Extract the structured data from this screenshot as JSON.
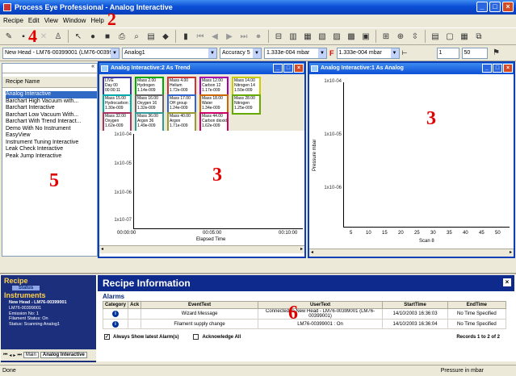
{
  "window": {
    "title": "Process Eye Professional - Analog Interactive"
  },
  "menu": [
    "Recipe",
    "Edit",
    "View",
    "Window",
    "Help"
  ],
  "callouts": {
    "menu": "2",
    "toolbar": "4",
    "left": "5",
    "trend": "3",
    "analog": "3",
    "bottom": "6"
  },
  "toolbar2": {
    "head": "New Head - LM76-00399001 (LM76-00399",
    "analog": "Analog1",
    "accuracy": "Accuracy 5",
    "start_mass": "1.333e-004 mbar",
    "end_mass": "1.333e-004 mbar",
    "value1": "1",
    "value2": "50"
  },
  "left_panel": {
    "header": "Recipe Name",
    "items": [
      "Analog Interactive",
      "Barchart High Vacuum with...",
      "Barchart Interactive",
      "Barchart Low Vacuum With...",
      "Barchart With Trend Interact...",
      "Demo With No Instrument",
      "EasyView",
      "Instrument Tuning Interactive",
      "Leak Check Interactive",
      "Peak Jump Interactive"
    ]
  },
  "trend_window": {
    "title": "Analog Interactive:2 As Trend",
    "cells": [
      {
        "label": "LIVE\nDay 00\n00:00:11",
        "color": "#3333aa"
      },
      {
        "label": "Mass 2.00\nHydrogen\n1.14e-009",
        "color": "#00aa00"
      },
      {
        "label": "Mass 4.00\nHelium\n1.72e-009",
        "color": "#cc3333"
      },
      {
        "label": "Mass 12.00\nCarbon 12\n1.17e-009",
        "color": "#aa00aa"
      },
      {
        "label": "Mass 14.00\nNitrogen 14\n1.50e-009",
        "color": "#cccc00"
      },
      {
        "label": "Mass 15.00\nHydrocarbon 15\n1.30e-009",
        "color": "#00aaaa"
      },
      {
        "label": "Mass 16.00\nOxygen 16\n1.32e-009",
        "color": "#666666"
      },
      {
        "label": "Mass 17.00\nOH group\n1.24e-009",
        "color": "#3366cc"
      },
      {
        "label": "Mass 18.00\nWater\n1.34e-009",
        "color": "#cc6600"
      },
      {
        "label": "Mass 28.00\nNitrogen\n1.25e-009",
        "color": "#66aa00"
      },
      {
        "label": "Mass 32.00\nOxygen\n1.62e-009",
        "color": "#aa3366"
      },
      {
        "label": "Mass 36.00\nArgon 36\n1.49e-009",
        "color": "#339999"
      },
      {
        "label": "Mass 40.00\nArgon\n1.71e-009",
        "color": "#999933"
      },
      {
        "label": "Mass 44.00\nCarbon dioxide\n1.62e-009",
        "color": "#cc0066"
      }
    ],
    "y_ticks": [
      "1x10-04",
      "1x10-05",
      "1x10-06",
      "1x10-07"
    ],
    "x_ticks": [
      "00:00:00",
      "00:05:00",
      "00:10:00"
    ],
    "xlabel": "Elapsed Time"
  },
  "analog_window": {
    "title": "Analog Interactive:1 As Analog",
    "y_ticks": [
      "1x10-04",
      "1x10-05",
      "1x10-06"
    ],
    "ylabel": "Pressure mbar",
    "x_ticks": [
      "5",
      "10",
      "15",
      "20",
      "25",
      "30",
      "35",
      "40",
      "45",
      "50"
    ],
    "xlabel": "Scan 8"
  },
  "bottom": {
    "recipe_header": "Recipe",
    "status_label": "Status",
    "instruments_header": "Instruments",
    "instrument_lines": [
      "New Head - LM76-00399001",
      "LM76-00399001",
      "Emission No: 1",
      "Filament Status: On",
      "Status: Scanning Analog1"
    ],
    "title": "Recipe Information",
    "alarms_title": "Alarms",
    "columns": [
      "Category",
      "Ack",
      "EventText",
      "UserText",
      "StartTime",
      "EndTime"
    ],
    "rows": [
      {
        "event": "Wizard Message",
        "user": "Connected to New Head - LM76-00399001 (LM76-00399001)",
        "start": "14/10/2003 16:36:03",
        "end": "No Time Specified"
      },
      {
        "event": "Filament supply change",
        "user": "LM76-00399001 : On",
        "start": "14/10/2003 16:36:04",
        "end": "No Time Specified"
      }
    ],
    "check1": "Always Show latest Alarm(s)",
    "check2": "Acknowledge All",
    "records": "Records 1 to 2 of 2",
    "tabs": [
      "Main",
      "Analog Interactive"
    ]
  },
  "status": {
    "left": "Done",
    "right": "Pressure in mbar"
  }
}
